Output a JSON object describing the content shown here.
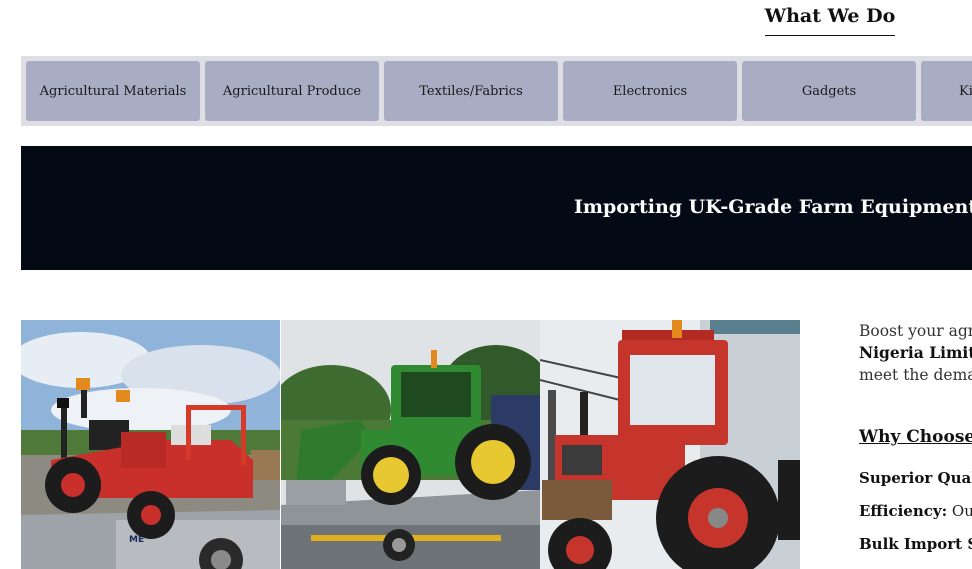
{
  "section": {
    "heading": "What We Do"
  },
  "tabs": [
    {
      "label": "Agricultural Materials"
    },
    {
      "label": "Agricultural Produce"
    },
    {
      "label": "Textiles/Fabrics"
    },
    {
      "label": "Electronics"
    },
    {
      "label": "Gadgets"
    },
    {
      "label": "Ki"
    }
  ],
  "banner": {
    "title": "Importing UK-Grade Farm Equipment and"
  },
  "gallery": {
    "images": [
      {
        "subject": "red compact tractor on trailer"
      },
      {
        "subject": "green tractor with front loader on flatbed"
      },
      {
        "subject": "red tractor with large tires"
      }
    ]
  },
  "intro": {
    "lines": [
      "Boost your agri",
      "Nigeria Limitec",
      "meet the demar"
    ],
    "why_heading": "Why Choose (",
    "features": [
      {
        "label": "Superior Quali",
        "text": ""
      },
      {
        "label": "Efficiency:",
        "text": " Our"
      },
      {
        "label": "Bulk Import Sa",
        "text": ""
      }
    ]
  },
  "colors": {
    "tab_bg": "#a9adc3",
    "tabbar_bg": "#dedee4",
    "banner_bg": "#030a15"
  }
}
